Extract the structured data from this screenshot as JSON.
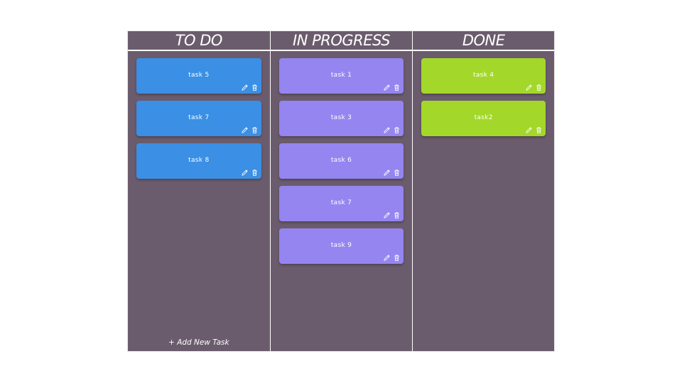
{
  "columns": [
    {
      "title": "TO DO",
      "color": "#3b8fe4",
      "cards": [
        {
          "title": "task 5"
        },
        {
          "title": "task 7"
        },
        {
          "title": "task 8"
        }
      ],
      "add_label": "+ Add New Task"
    },
    {
      "title": "IN PROGRESS",
      "color": "#9585f0",
      "cards": [
        {
          "title": "task 1"
        },
        {
          "title": "task 3"
        },
        {
          "title": "task 6"
        },
        {
          "title": "task 7"
        },
        {
          "title": "task 9"
        }
      ]
    },
    {
      "title": "DONE",
      "color": "#a3d72a",
      "cards": [
        {
          "title": "task 4"
        },
        {
          "title": "task2"
        }
      ]
    }
  ],
  "icons": {
    "edit": "pencil-icon",
    "delete": "trash-icon"
  },
  "colors": {
    "column_bg": "#6b5c6d",
    "text": "#ffffff"
  }
}
